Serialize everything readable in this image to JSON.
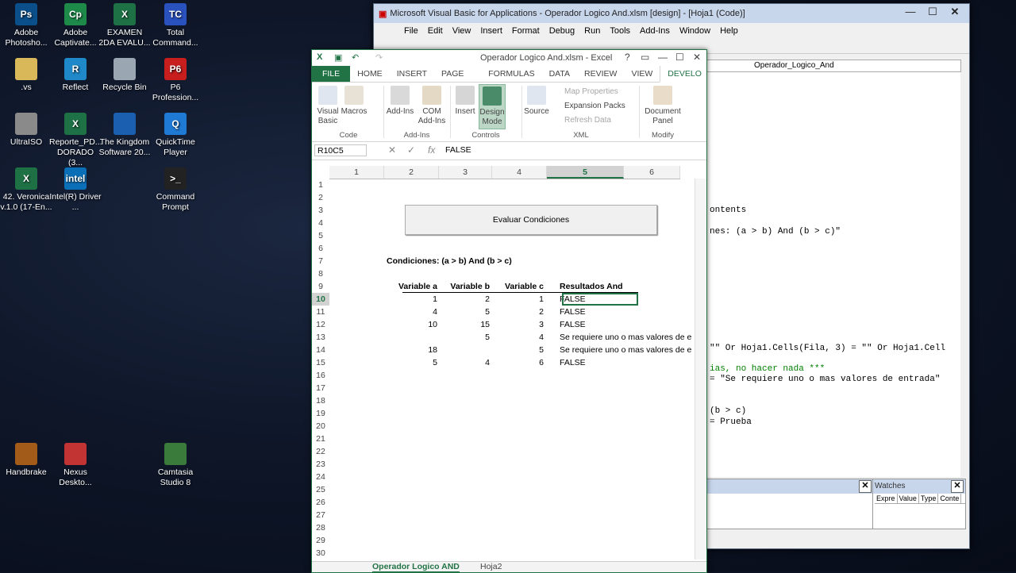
{
  "desktop": {
    "icons": [
      {
        "label": "Adobe Photosho...",
        "glyph": "Ps",
        "color": "#0b4f8a"
      },
      {
        "label": "Adobe Captivate...",
        "glyph": "Cp",
        "color": "#1d8a4a"
      },
      {
        "label": "EXAMEN 2DA EVALU...",
        "glyph": "X",
        "color": "#1e7145"
      },
      {
        "label": "Total Command...",
        "glyph": "TC",
        "color": "#2a52be"
      },
      {
        "label": ".vs",
        "glyph": "",
        "color": "#d9b85a"
      },
      {
        "label": "Reflect",
        "glyph": "R",
        "color": "#1e88c8"
      },
      {
        "label": "Recycle Bin",
        "glyph": "",
        "color": "#9aa6b2"
      },
      {
        "label": "P6 Profession...",
        "glyph": "P6",
        "color": "#c81e1e"
      },
      {
        "label": "UltraISO",
        "glyph": "",
        "color": "#8a8a8a"
      },
      {
        "label": "Reporte_PD... DORADO (3...",
        "glyph": "X",
        "color": "#1e7145"
      },
      {
        "label": "The Kingdom Software 20...",
        "glyph": "",
        "color": "#1b5fb0"
      },
      {
        "label": "QuickTime Player",
        "glyph": "Q",
        "color": "#1f7ad6"
      },
      {
        "label": "42. Veronica v.1.0 (17-En...",
        "glyph": "X",
        "color": "#1e7145"
      },
      {
        "label": "Intel(R) Driver ...",
        "glyph": "intel",
        "color": "#0b6fb8"
      },
      {
        "label": "Command Prompt",
        "glyph": ">_",
        "color": "#222"
      },
      {
        "label": "Handbrake",
        "glyph": "",
        "color": "#a35b1a"
      },
      {
        "label": "Nexus Deskto...",
        "glyph": "",
        "color": "#c23333"
      },
      {
        "label": "Camtasia Studio 8",
        "glyph": "",
        "color": "#3a7a3a"
      }
    ]
  },
  "vba": {
    "title": "Microsoft Visual Basic for Applications - Operador Logico And.xlsm [design] - [Hoja1 (Code)]",
    "menu": [
      "File",
      "Edit",
      "View",
      "Insert",
      "Format",
      "Debug",
      "Run",
      "Tools",
      "Add-Ins",
      "Window",
      "Help"
    ],
    "procedure": "Operador_Logico_And",
    "code_lines": [
      {
        "text": "ontents",
        "comment": false
      },
      {
        "text": "nes: (a > b) And (b > c)\"",
        "comment": false
      },
      {
        "text": "\"\" Or Hoja1.Cells(Fila, 3) = \"\" Or Hoja1.Cell",
        "comment": false
      },
      {
        "text": "ias, no hacer nada ***",
        "comment": true
      },
      {
        "text": "= \"Se requiere uno o mas valores de entrada\"",
        "comment": false
      },
      {
        "text": "(b > c)",
        "comment": false
      },
      {
        "text": "= Prueba",
        "comment": false
      }
    ],
    "watches": {
      "title": "Watches",
      "columns": [
        "Expre",
        "Value",
        "Type",
        "Conte"
      ]
    }
  },
  "excel": {
    "title": "Operador Logico And.xlsm - Excel",
    "window_controls": [
      "?",
      "▭",
      "—",
      "☐",
      "✕"
    ],
    "tabs": [
      "FILE",
      "HOME",
      "INSERT",
      "PAGE LAYOUT",
      "FORMULAS",
      "DATA",
      "REVIEW",
      "VIEW",
      "DEVELO"
    ],
    "ribbon": {
      "visual_basic": "Visual Basic",
      "macros": "Macros",
      "code_group": "Code",
      "add_ins": "Add-Ins",
      "com_add_ins": "COM Add-Ins",
      "addins_group": "Add-Ins",
      "insert": "Insert",
      "design_mode": "Design Mode",
      "controls_group": "Controls",
      "source": "Source",
      "map_properties": "Map Properties",
      "expansion_packs": "Expansion Packs",
      "refresh_data": "Refresh Data",
      "xml_group": "XML",
      "document_panel": "Document Panel",
      "modify_group": "Modify"
    },
    "name_box": "R10C5",
    "formula": "FALSE",
    "columns": [
      "1",
      "2",
      "3",
      "4",
      "5",
      "6"
    ],
    "selected_column": "5",
    "rows": [
      "1",
      "2",
      "3",
      "4",
      "5",
      "6",
      "7",
      "8",
      "9",
      "10",
      "11",
      "12",
      "13",
      "14",
      "15",
      "16",
      "17",
      "18",
      "19",
      "20",
      "21",
      "22",
      "23",
      "24",
      "25",
      "26",
      "27",
      "28",
      "29",
      "30"
    ],
    "selected_row": "10",
    "button_label": "Evaluar Condiciones",
    "conditions_label": "Condiciones: (a > b) And (b > c)",
    "headers": [
      "Variable a",
      "Variable b",
      "Variable c",
      "Resultados And"
    ],
    "data_rows": [
      [
        "1",
        "2",
        "1",
        "FALSE"
      ],
      [
        "4",
        "5",
        "2",
        "FALSE"
      ],
      [
        "10",
        "15",
        "3",
        "FALSE"
      ],
      [
        "",
        "5",
        "4",
        "Se requiere uno o mas valores de e"
      ],
      [
        "18",
        "",
        "5",
        "Se requiere uno o mas valores de e"
      ],
      [
        "5",
        "4",
        "6",
        "FALSE"
      ]
    ],
    "sheet_tabs": [
      "Operador Logico AND",
      "Hoja2"
    ]
  }
}
